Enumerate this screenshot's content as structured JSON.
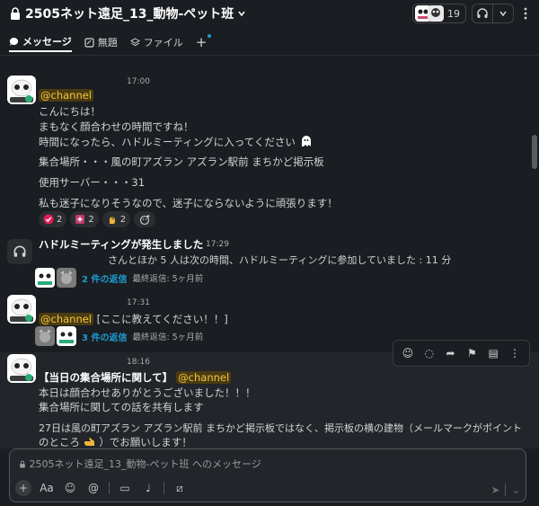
{
  "channel": {
    "name": "2505ネット遠足_13_動物-ペット班",
    "member_count": "19"
  },
  "tabs": [
    {
      "label": "メッセージ",
      "icon": "message-icon",
      "active": true
    },
    {
      "label": "無題",
      "icon": "canvas-icon",
      "active": false
    },
    {
      "label": "ファイル",
      "icon": "files-icon",
      "active": false
    }
  ],
  "messages": [
    {
      "time": "17:00",
      "lines": [
        "@channel",
        "こんにちは！",
        "まもなく顔合わせの時間ですね！",
        "時間になったら、ハドルミーティングに入ってください",
        "集合場所・・・風の町アズラン アズラン駅前 まちかど掲示板",
        "使用サーバー・・・31",
        "私も迷子になりそうなので、迷子にならないように頑張ります！"
      ],
      "reactions": [
        {
          "emoji": "check-icon",
          "count": "2"
        },
        {
          "emoji": "sparkle-icon",
          "count": "2"
        },
        {
          "emoji": "hand-icon",
          "count": "2"
        }
      ]
    },
    {
      "time": "17:29",
      "title": "ハドルミーティングが発生しました",
      "body": "さんとほか 5 人は次の時間、ハドルミーティングに参加していました : 11 分",
      "thread_link": "2 件の返信",
      "thread_last": "最終返信: 5ヶ月前"
    },
    {
      "time": "17:31",
      "mention": "@channel",
      "text": "[ここに教えてください！！]",
      "thread_link": "3 件の返信",
      "thread_last": "最終返信: 5ヶ月前"
    },
    {
      "time": "18:16",
      "title": "【当日の集合場所に関して】",
      "mention": "@channel",
      "lines": [
        "本日は顔合わせありがとうございました！！！",
        "集合場所に関しての話を共有します",
        "27日は風の町アズラン アズラン駅前 まちかど掲示板ではなく、掲示板の横の建物（メールマークがポイント",
        "のところ",
        "）でお願いします！"
      ]
    }
  ],
  "composer": {
    "placeholder": "2505ネット遠足_13_動物-ペット班 へのメッセージ",
    "format_label": "Aa"
  },
  "colors": {
    "background": "#1a1d21",
    "link": "#1d9bd1",
    "mention_text": "#f2c744",
    "mention_bg": "#4a3b10"
  }
}
